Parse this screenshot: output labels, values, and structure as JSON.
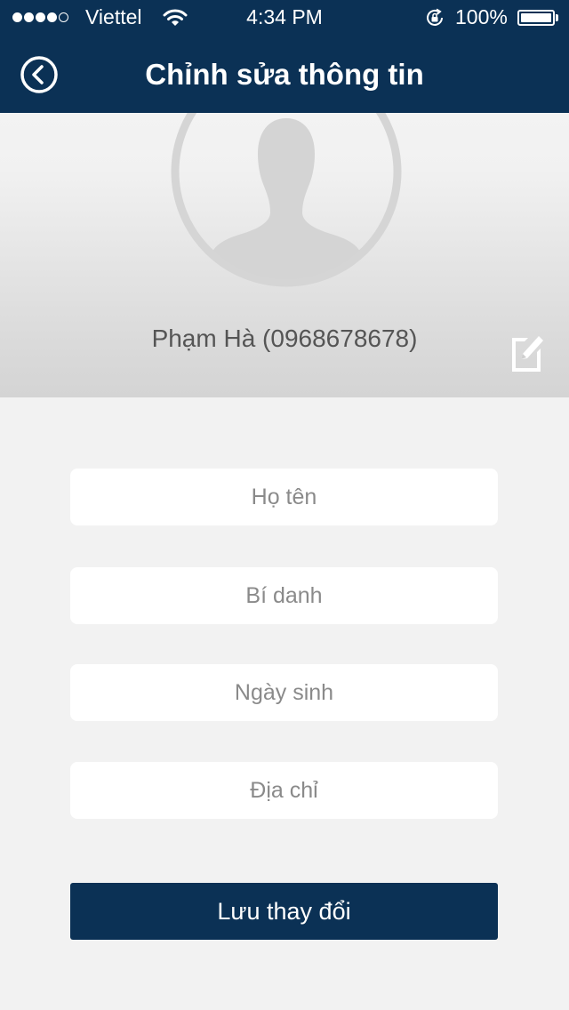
{
  "status_bar": {
    "signal_bars_filled": 4,
    "signal_bars_total": 5,
    "carrier": "Viettel",
    "time": "4:34 PM",
    "battery_percent": "100%",
    "battery_level": 1.0
  },
  "nav": {
    "title": "Chỉnh sửa thông tin",
    "back_icon": "back-chevron-circle-icon"
  },
  "profile": {
    "name_phone": "Phạm Hà (0968678678)",
    "avatar_icon": "person-silhouette-icon",
    "edit_icon": "edit-pencil-icon"
  },
  "form": {
    "full_name": {
      "value": "",
      "placeholder": "Họ tên"
    },
    "nickname": {
      "value": "",
      "placeholder": "Bí danh"
    },
    "birthday": {
      "value": "",
      "placeholder": "Ngày sinh"
    },
    "address": {
      "value": "",
      "placeholder": "Địa chỉ"
    },
    "save_label": "Lưu thay đổi"
  },
  "colors": {
    "primary": "#0b3155",
    "background": "#f2f2f2",
    "field_background": "#ffffff",
    "placeholder": "#8a8a8a"
  }
}
